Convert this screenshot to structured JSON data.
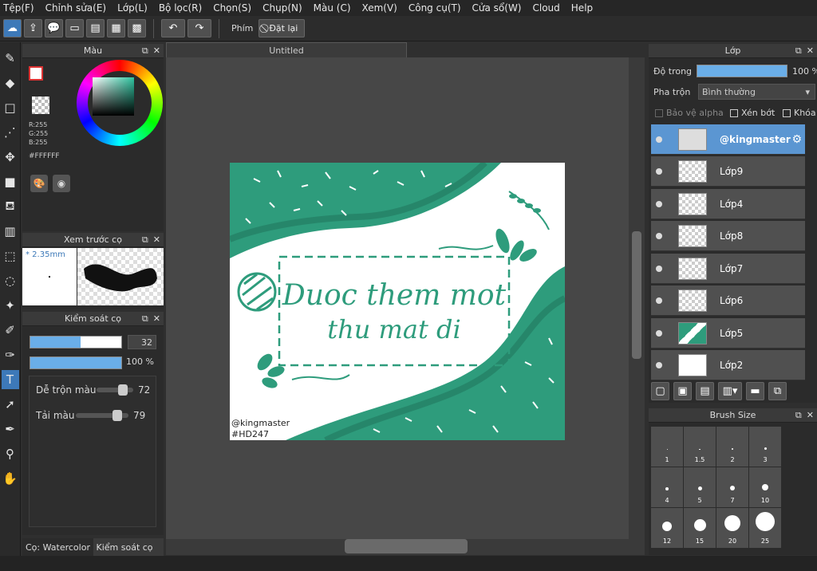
{
  "menu": [
    "Tệp(F)",
    "Chỉnh sửa(E)",
    "Lớp(L)",
    "Bộ lọc(R)",
    "Chọn(S)",
    "Chụp(N)",
    "Màu (C)",
    "Xem(V)",
    "Công cụ(T)",
    "Cửa sổ(W)",
    "Cloud",
    "Help"
  ],
  "toolbar": {
    "shortcut_label": "Phím",
    "reset_label": "Đặt lại"
  },
  "color_panel": {
    "title": "Màu",
    "r": "R:255",
    "g": "G:255",
    "b": "B:255",
    "hex": "#FFFFFF"
  },
  "brush_preview": {
    "title": "Xem trước cọ",
    "size": "* 2.35mm"
  },
  "brush_control": {
    "title": "Kiểm soát cọ",
    "size_value": "32",
    "opacity_value": "100 %",
    "blend_label": "Dễ trộn màu",
    "blend_value": "72",
    "load_label": "Tải màu",
    "load_value": "79",
    "size_fill": 0.55,
    "blend_fill": 0.72,
    "load_fill": 0.79
  },
  "bottom_tabs": [
    "Cọ: Watercolor (Wet",
    "Kiểm soát cọ"
  ],
  "document": {
    "tab": "Untitled",
    "art_text_line1": "Duoc them mot",
    "art_text_line2": "thu mat di",
    "watermark1": "@kingmaster",
    "watermark2": "#HD247"
  },
  "layer_panel": {
    "title": "Lớp",
    "opacity_label": "Độ trong",
    "opacity_value": "100 %",
    "blend_label": "Pha trộn",
    "blend_value": "Bình thường",
    "protect_alpha": "Bảo vệ alpha",
    "clipping": "Xén bớt",
    "lock": "Khóa",
    "layers": [
      "@kingmaster",
      "Lớp9",
      "Lớp4",
      "Lớp8",
      "Lớp7",
      "Lớp6",
      "Lớp5",
      "Lớp2"
    ]
  },
  "brush_size_panel": {
    "title": "Brush Size",
    "sizes": [
      "1",
      "1.5",
      "2",
      "3",
      "4",
      "5",
      "7",
      "10",
      "12",
      "15",
      "20",
      "25"
    ]
  },
  "colors": {
    "accent": "#3d79b8",
    "art_green": "#2e9c7c",
    "layer_selected": "#5b96d2"
  }
}
